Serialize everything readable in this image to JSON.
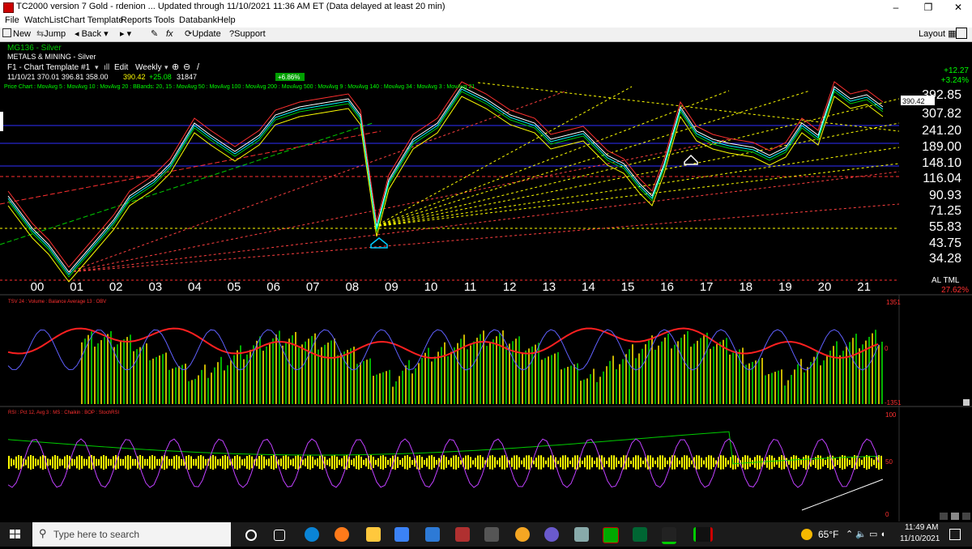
{
  "window": {
    "title": "TC2000 version 7 Gold - rdenion  ... Updated through 11/10/2021 11:36 AM ET (Data delayed at least 20 min)",
    "minimize": "–",
    "restore": "❐",
    "close": "✕"
  },
  "menu": [
    "File",
    "WatchList",
    "Chart Template",
    "Reports",
    "Tools",
    "Databank",
    "Help"
  ],
  "toolbar": {
    "new": "New",
    "jump": "Jump",
    "back": "Back",
    "update": "Update",
    "support": "Support",
    "layout": "Layout",
    "fx": "fx"
  },
  "chart": {
    "symbol": "MG136 - Silver",
    "industry": "METALS & MINING - Silver",
    "template": "F1 - Chart Template #1",
    "edit": "Edit",
    "period": "Weekly",
    "ohlc_line": "11/10/21  370.01  396.81  358.00",
    "last_price": "390.42",
    "change": "+25.08",
    "volume": "31847",
    "pct_badge": "+6.86%",
    "right_change": "+12.27",
    "right_pct": "+3.24%",
    "indicator_line": "Price Chart : MovAvg 5 : MovAvg 10 : MovAvg 20 : BBands: 20, 15 : MovAvg 50 : MovAvg 100 : MovAvg 200 : MovAvg 500 : MovAvg 9 : MovAvg 140 : MovAvg 34 : MovAvg 3 : MovAvg 21",
    "price_tag": "390.42",
    "price_axis": [
      "392.85",
      "307.82",
      "241.20",
      "189.00",
      "148.10",
      "116.04",
      "90.93",
      "71.25",
      "55.83",
      "43.75",
      "34.28"
    ],
    "year_axis": [
      "00",
      "01",
      "02",
      "03",
      "04",
      "05",
      "06",
      "07",
      "08",
      "09",
      "10",
      "11",
      "12",
      "13",
      "14",
      "15",
      "16",
      "17",
      "18",
      "19",
      "20",
      "21"
    ],
    "scale_mode": "AL TML",
    "scale_pct": "27.62%",
    "volume_panel_label": "TSV 24 : Volume : Balance Average 13 : OBV",
    "volume_axis_top": "1351",
    "volume_axis_zero": "0",
    "volume_axis_bottom": "-1351",
    "rsi_panel_label": "RSI : Pct 12, Avg 3 : MS : Chaikin : BOP : StochRSI",
    "rsi_axis_top": "100",
    "rsi_axis_mid": "50",
    "rsi_axis_bottom": "0",
    "colors": {
      "price_line": "#ffffff",
      "ma_yellow": "#ffff00",
      "ma_green": "#00cc00",
      "ma_red": "#ff2020",
      "ma_blue": "#4040ff",
      "axis_text": "#ffffff",
      "accent_red": "#ff3030"
    }
  },
  "taskbar": {
    "search_placeholder": "Type here to search",
    "weather": "65°F",
    "time": "11:49 AM",
    "date": "11/10/2021"
  }
}
